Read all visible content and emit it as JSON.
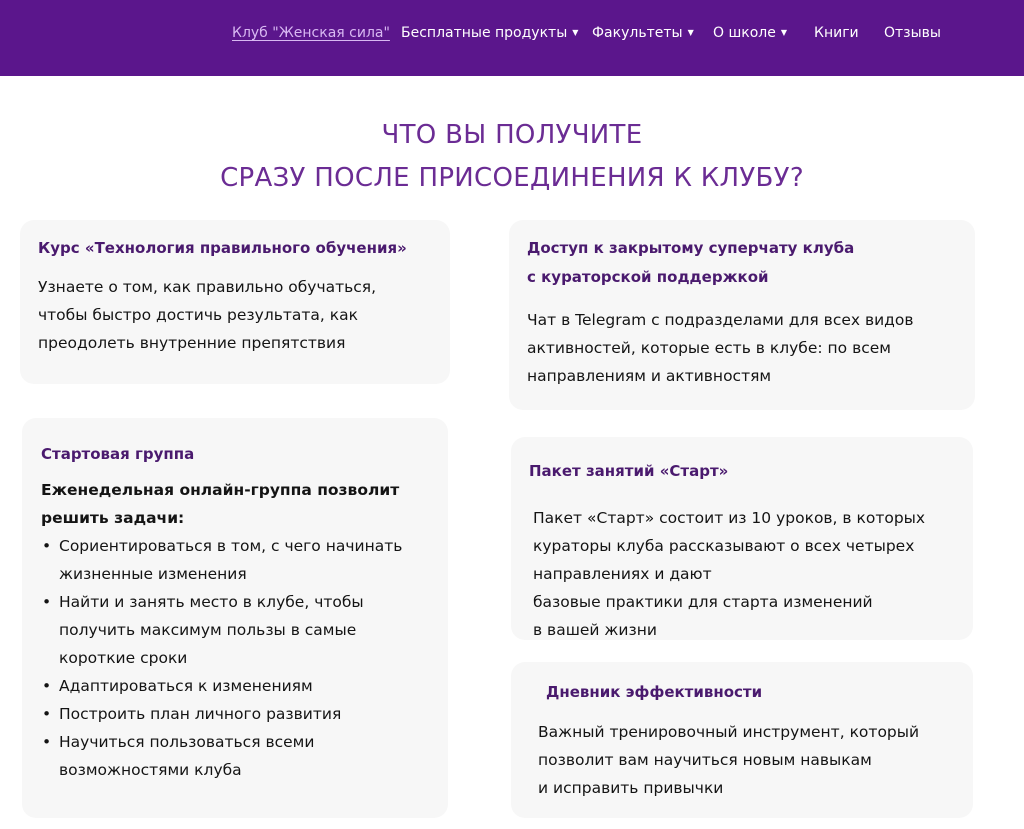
{
  "nav": {
    "club": "Клуб \"Женская сила\"",
    "free_products": "Бесплатные продукты",
    "faculties": "Факультеты",
    "about": "О школе",
    "books": "Книги",
    "reviews": "Отзывы",
    "caret": "▼"
  },
  "headline": {
    "line1": "ЧТО ВЫ ПОЛУЧИТЕ",
    "line2": "СРАЗУ ПОСЛЕ ПРИСОЕДИНЕНИЯ К КЛУБУ?"
  },
  "cards": {
    "course": {
      "title": "Курс «Технология правильного обучения»",
      "lines": [
        "Узнаете о том, как правильно обучаться,",
        "чтобы быстро достичь результата, как",
        "преодолеть внутренние препятствия"
      ]
    },
    "chat": {
      "title_lines": [
        "Доступ к закрытому суперчату клуба",
        "с кураторской поддержкой"
      ],
      "lines": [
        "Чат в Telegram с подразделами для всех видов",
        "активностей, которые есть в клубе: по всем",
        "направлениям и активностям"
      ]
    },
    "start_group": {
      "title": "Стартовая группа",
      "intro_lines": [
        "Еженедельная онлайн-группа позволит",
        "решить задачи:"
      ],
      "bullets": [
        [
          "Сориентироваться в том, с чего начинать",
          "жизненные изменения"
        ],
        [
          "Найти и занять место в клубе, чтобы",
          "получить максимум пользы в самые",
          "короткие сроки"
        ],
        [
          "Адаптироваться к изменениям"
        ],
        [
          "Построить план личного развития"
        ],
        [
          "Научиться пользоваться всеми",
          "возможностями клуба"
        ]
      ]
    },
    "start_pack": {
      "title": "Пакет занятий «Старт»",
      "lines": [
        "Пакет «Старт» состоит из 10 уроков, в которых",
        "кураторы клуба рассказывают о всех четырех",
        "направлениях и дают",
        "базовые практики для старта изменений",
        "в вашей жизни"
      ]
    },
    "diary": {
      "title": "Дневник эффективности",
      "lines": [
        "Важный тренировочный инструмент, который",
        "позволит вам научиться новым навыкам",
        "и исправить привычки"
      ]
    }
  }
}
